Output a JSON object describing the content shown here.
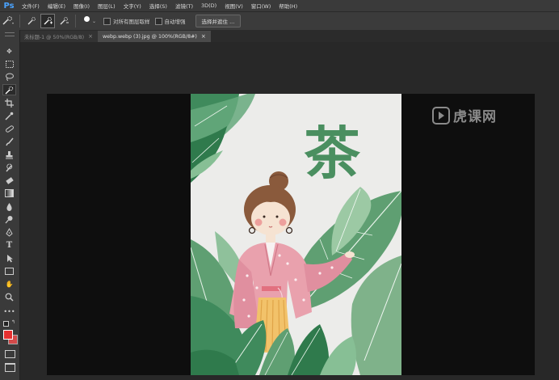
{
  "app": {
    "logo": "Ps"
  },
  "menu": [
    "文件(F)",
    "编辑(E)",
    "图像(I)",
    "图层(L)",
    "文字(Y)",
    "选择(S)",
    "滤镜(T)",
    "3D(D)",
    "视图(V)",
    "窗口(W)",
    "帮助(H)"
  ],
  "options": {
    "brush_size": "30",
    "sample_all_layers_label": "对所有图层取样",
    "auto_enhance_label": "自动增强",
    "select_and_mask_label": "选择并遮住 ..."
  },
  "tabs": [
    {
      "label": "未标题-1 @ 50%(RGB/8)",
      "close": "×"
    },
    {
      "label": "webp.webp (3).jpg @ 100%(RGB/8#)",
      "close": "×"
    }
  ],
  "image": {
    "title_char": "茶"
  },
  "watermark": {
    "text": "虎课网"
  },
  "colors": {
    "foreground": "#e53030",
    "background": "#d34a4a",
    "accent": "#4aa3ff"
  },
  "tools": [
    "move-tool",
    "marquee-tool",
    "lasso-tool",
    "quick-selection-tool",
    "crop-tool",
    "eyedropper-tool",
    "healing-brush-tool",
    "brush-tool",
    "clone-stamp-tool",
    "history-brush-tool",
    "eraser-tool",
    "gradient-tool",
    "blur-tool",
    "dodge-tool",
    "pen-tool",
    "type-tool",
    "path-selection-tool",
    "rectangle-tool",
    "hand-tool",
    "zoom-tool",
    "more-tools"
  ]
}
